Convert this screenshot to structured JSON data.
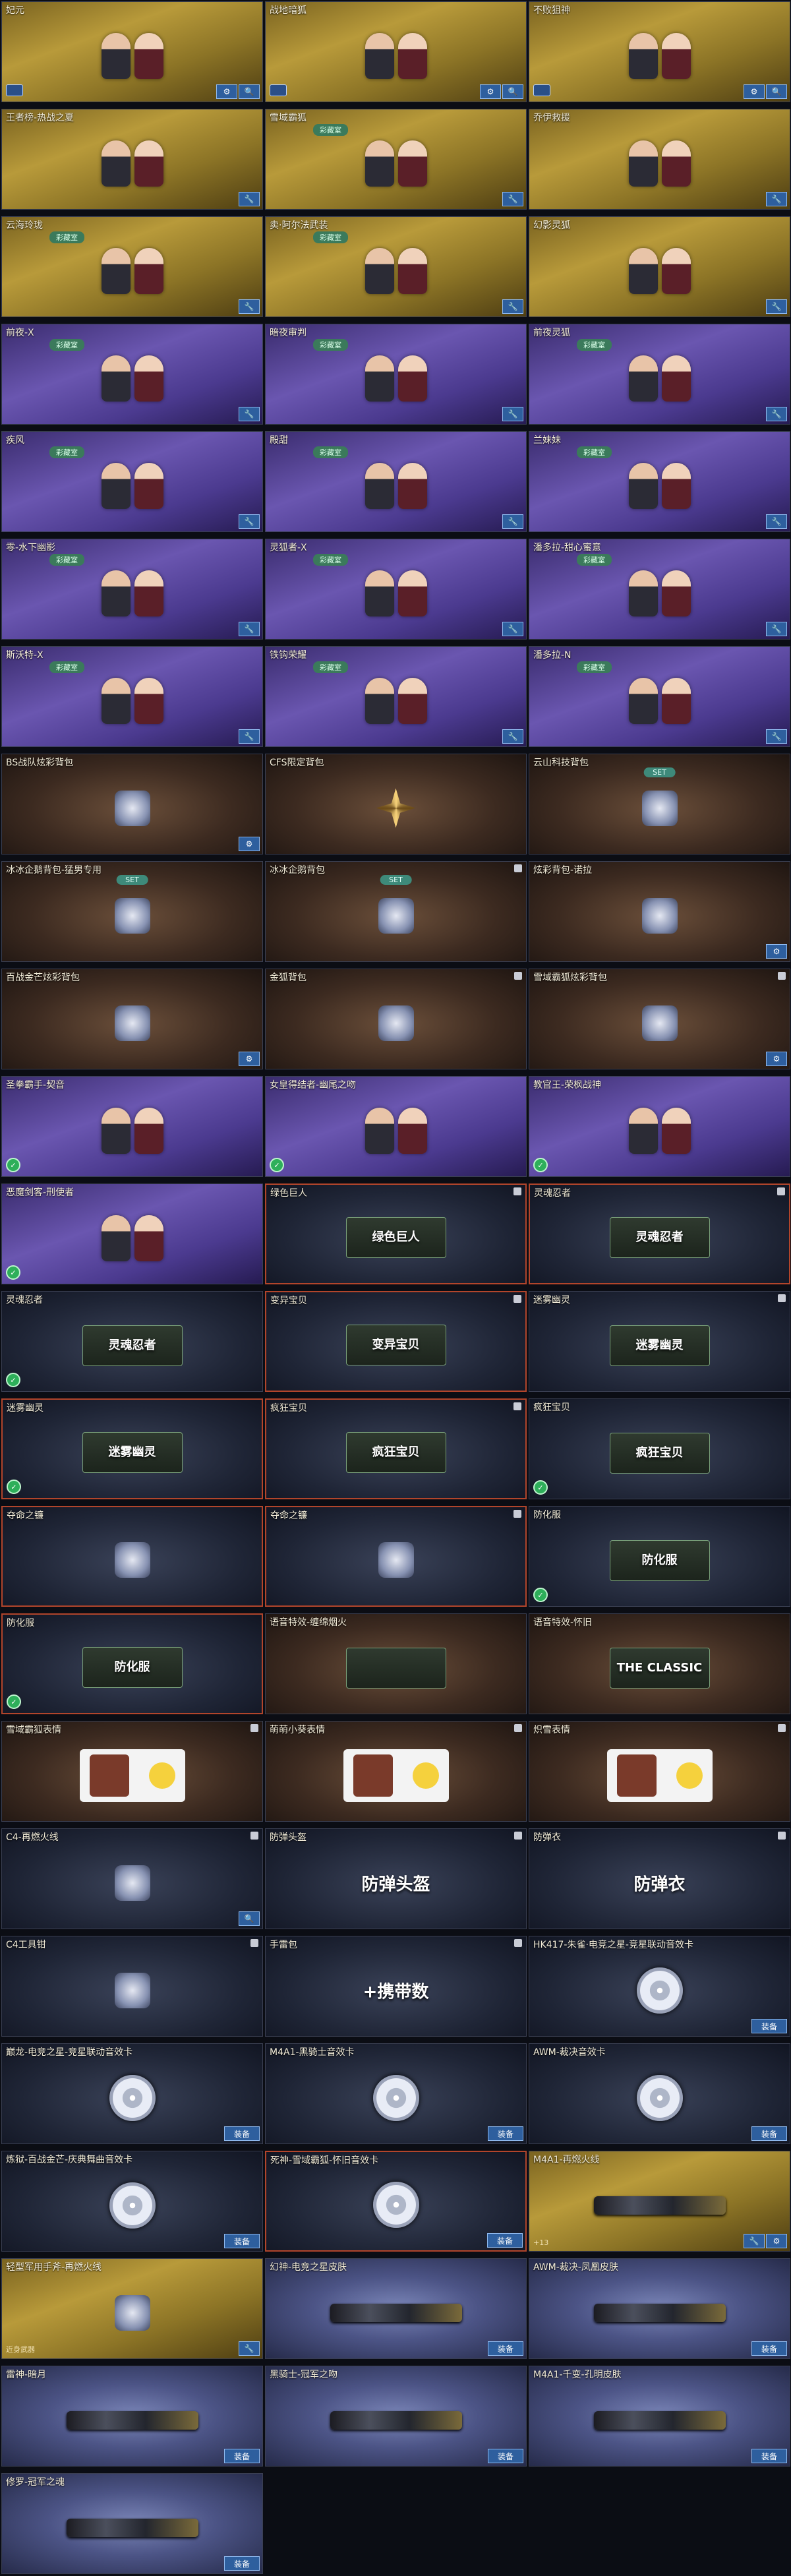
{
  "cards": [
    {
      "title": "妃元",
      "bg": "gold",
      "art": "chars",
      "vip": true,
      "buttons": [
        "gear",
        "search"
      ]
    },
    {
      "title": "战地暗狐",
      "bg": "gold",
      "art": "chars",
      "vip": true,
      "buttons": [
        "gear",
        "search"
      ]
    },
    {
      "title": "不败狙神",
      "bg": "gold",
      "art": "chars",
      "vip": true,
      "buttons": [
        "gear",
        "search"
      ]
    },
    {
      "title": "王者榜-热战之夏",
      "bg": "gold",
      "art": "chars",
      "buttons": [
        "wrench"
      ]
    },
    {
      "title": "雪域霸狐",
      "bg": "gold",
      "art": "chars",
      "tag": "彩藏室",
      "buttons": [
        "wrench"
      ]
    },
    {
      "title": "乔伊救援",
      "bg": "gold",
      "art": "chars",
      "buttons": [
        "wrench"
      ]
    },
    {
      "title": "云海玲珑",
      "bg": "gold",
      "art": "chars",
      "tag": "彩藏室",
      "buttons": [
        "wrench"
      ]
    },
    {
      "title": "卖·阿尔法武装",
      "bg": "gold",
      "art": "chars",
      "tag": "彩藏室",
      "buttons": [
        "wrench"
      ]
    },
    {
      "title": "幻影灵狐",
      "bg": "gold",
      "art": "chars",
      "buttons": [
        "wrench"
      ]
    },
    {
      "title": "前夜-X",
      "bg": "purple",
      "art": "chars",
      "tag": "彩藏室",
      "buttons": [
        "wrench"
      ]
    },
    {
      "title": "暗夜审判",
      "bg": "purple",
      "art": "chars",
      "tag": "彩藏室",
      "buttons": [
        "wrench"
      ]
    },
    {
      "title": "前夜灵狐",
      "bg": "purple",
      "art": "chars",
      "tag": "彩藏室",
      "buttons": [
        "wrench"
      ]
    },
    {
      "title": "疾风",
      "bg": "purple",
      "art": "chars",
      "tag": "彩藏室",
      "buttons": [
        "wrench"
      ]
    },
    {
      "title": "殿甜",
      "bg": "purple",
      "art": "chars",
      "tag": "彩藏室",
      "buttons": [
        "wrench"
      ]
    },
    {
      "title": "兰妹妹",
      "bg": "purple",
      "art": "chars",
      "tag": "彩藏室",
      "buttons": [
        "wrench"
      ]
    },
    {
      "title": "零-水下幽影",
      "bg": "purple",
      "art": "chars",
      "tag": "彩藏室",
      "buttons": [
        "wrench"
      ]
    },
    {
      "title": "灵狐者-X",
      "bg": "purple",
      "art": "chars",
      "tag": "彩藏室",
      "buttons": [
        "wrench"
      ]
    },
    {
      "title": "潘多拉-甜心蜜意",
      "bg": "purple",
      "art": "chars",
      "tag": "彩藏室",
      "buttons": [
        "wrench"
      ]
    },
    {
      "title": "斯沃特-X",
      "bg": "purple",
      "art": "chars",
      "tag": "彩藏室",
      "buttons": [
        "wrench"
      ]
    },
    {
      "title": "铁钩荣耀",
      "bg": "purple",
      "art": "chars",
      "tag": "彩藏室",
      "buttons": [
        "wrench"
      ]
    },
    {
      "title": "潘多拉-N",
      "bg": "purple",
      "art": "chars",
      "tag": "彩藏室",
      "buttons": [
        "wrench"
      ]
    },
    {
      "title": "BS战队炫彩背包",
      "bg": "brown",
      "art": "item",
      "buttons": [
        "gear"
      ]
    },
    {
      "title": "CFS限定背包",
      "bg": "brown",
      "art": "star"
    },
    {
      "title": "云山科技背包",
      "bg": "brown",
      "art": "item",
      "set": "SET"
    },
    {
      "title": "冰冰企鹅背包-猛男专用",
      "bg": "brown",
      "art": "item",
      "set": "SET"
    },
    {
      "title": "冰冰企鹅背包",
      "bg": "brown",
      "art": "item",
      "set": "SET",
      "lock": true
    },
    {
      "title": "炫彩背包-诺拉",
      "bg": "brown",
      "art": "item",
      "buttons": [
        "gear"
      ]
    },
    {
      "title": "百战金芒炫彩背包",
      "bg": "brown",
      "art": "item",
      "buttons": [
        "gear"
      ]
    },
    {
      "title": "金狐背包",
      "bg": "brown",
      "art": "item",
      "lock": true
    },
    {
      "title": "雪域霸狐炫彩背包",
      "bg": "brown",
      "art": "item",
      "lock": true,
      "buttons": [
        "gear"
      ]
    },
    {
      "title": "圣拳霸手-契音",
      "bg": "purple",
      "art": "chars",
      "badge": true
    },
    {
      "title": "女皇得结者-幽尾之吻",
      "bg": "purple",
      "art": "chars",
      "badge": true
    },
    {
      "title": "教官王-荣枫战神",
      "bg": "purple",
      "art": "chars",
      "badge": true
    },
    {
      "title": "恶魔剑客-刑使者",
      "bg": "purple",
      "art": "chars",
      "badge": true
    },
    {
      "title": "绿色巨人",
      "bg": "dark",
      "art": "panel",
      "panelText": "绿色巨人",
      "hot": true,
      "lock": true
    },
    {
      "title": "灵魂忍者",
      "bg": "dark",
      "art": "panel",
      "panelText": "灵魂忍者",
      "hot": true,
      "lock": true
    },
    {
      "title": "灵魂忍者",
      "bg": "dark",
      "art": "panel",
      "panelText": "灵魂忍者",
      "badge": true
    },
    {
      "title": "变异宝贝",
      "bg": "dark",
      "art": "panel",
      "panelText": "变异宝贝",
      "hot": true,
      "lock": true
    },
    {
      "title": "迷雾幽灵",
      "bg": "dark",
      "art": "panel",
      "panelText": "迷雾幽灵",
      "lock": true
    },
    {
      "title": "迷雾幽灵",
      "bg": "dark",
      "art": "panel",
      "panelText": "迷雾幽灵",
      "hot": true,
      "badge": true
    },
    {
      "title": "疯狂宝贝",
      "bg": "dark",
      "art": "panel",
      "panelText": "疯狂宝贝",
      "hot": true,
      "lock": true
    },
    {
      "title": "疯狂宝贝",
      "bg": "dark",
      "art": "panel",
      "panelText": "疯狂宝贝",
      "badge": true
    },
    {
      "title": "夺命之镰",
      "bg": "dark",
      "art": "item",
      "hot": true
    },
    {
      "title": "夺命之镰",
      "bg": "dark",
      "art": "item",
      "hot": true,
      "lock": true
    },
    {
      "title": "防化服",
      "bg": "dark",
      "art": "panel",
      "panelText": "防化服",
      "badge": true
    },
    {
      "title": "防化服",
      "bg": "dark",
      "art": "panel",
      "panelText": "防化服",
      "hot": true,
      "badge": true
    },
    {
      "title": "语音特效-缠绵烟火",
      "bg": "brown",
      "art": "panel",
      "panelText": ""
    },
    {
      "title": "语音特效-怀旧",
      "bg": "brown",
      "art": "panel",
      "panelText": "THE CLASSIC"
    },
    {
      "title": "雪域霸狐表情",
      "bg": "brown",
      "art": "emote",
      "lock": true
    },
    {
      "title": "萌萌小葵表情",
      "bg": "brown",
      "art": "emote",
      "lock": true
    },
    {
      "title": "炽雪表情",
      "bg": "brown",
      "art": "emote",
      "lock": true
    },
    {
      "title": "C4-再燃火线",
      "bg": "dark",
      "art": "item",
      "lock": true,
      "buttons": [
        "search"
      ]
    },
    {
      "title": "防弹头盔",
      "bg": "dark",
      "art": "label",
      "labelText": "防弹头盔",
      "lock": true
    },
    {
      "title": "防弹衣",
      "bg": "dark",
      "art": "label",
      "labelText": "防弹衣",
      "lock": true
    },
    {
      "title": "C4工具钳",
      "bg": "dark",
      "art": "item",
      "lock": true
    },
    {
      "title": "手雷包",
      "bg": "dark",
      "art": "label",
      "labelText": "+携带数",
      "lock": true
    },
    {
      "title": "HK417-朱雀·电竞之星-竞星联动音效卡",
      "bg": "dark",
      "art": "disc",
      "equip": "装备"
    },
    {
      "title": "巅龙-电竞之星-竞星联动音效卡",
      "bg": "dark",
      "art": "disc",
      "equip": "装备"
    },
    {
      "title": "M4A1-黑骑士音效卡",
      "bg": "dark",
      "art": "disc",
      "equip": "装备"
    },
    {
      "title": "AWM-裁决音效卡",
      "bg": "dark",
      "art": "disc",
      "equip": "装备"
    },
    {
      "title": "炼狱-百战金芒-庆典舞曲音效卡",
      "bg": "dark",
      "art": "disc",
      "equip": "装备"
    },
    {
      "title": "死神-雪域霸狐-怀旧音效卡",
      "bg": "dark",
      "art": "disc",
      "hot": true,
      "equip": "装备"
    },
    {
      "title": "M4A1-再燃火线",
      "bg": "gold",
      "art": "gun",
      "subtext": "+13",
      "buttons": [
        "wrench",
        "gear"
      ]
    },
    {
      "title": "轻型军用手斧-再燃火线",
      "bg": "gold",
      "art": "item",
      "subtext": "近身武器",
      "buttons": [
        "wrench"
      ]
    },
    {
      "title": "幻神-电竞之星皮肤",
      "bg": "mist",
      "art": "gun",
      "equip": "装备"
    },
    {
      "title": "AWM-裁决-凤凰皮肤",
      "bg": "mist",
      "art": "gun",
      "equip": "装备"
    },
    {
      "title": "雷神-暗月",
      "bg": "mist",
      "art": "gun",
      "equip": "装备"
    },
    {
      "title": "黑骑士-冠军之吻",
      "bg": "mist",
      "art": "gun",
      "equip": "装备"
    },
    {
      "title": "M4A1-千变-孔明皮肤",
      "bg": "mist",
      "art": "gun",
      "equip": "装备"
    },
    {
      "title": "修罗-冠军之魂",
      "bg": "mist",
      "art": "gun",
      "equip": "装备"
    }
  ]
}
